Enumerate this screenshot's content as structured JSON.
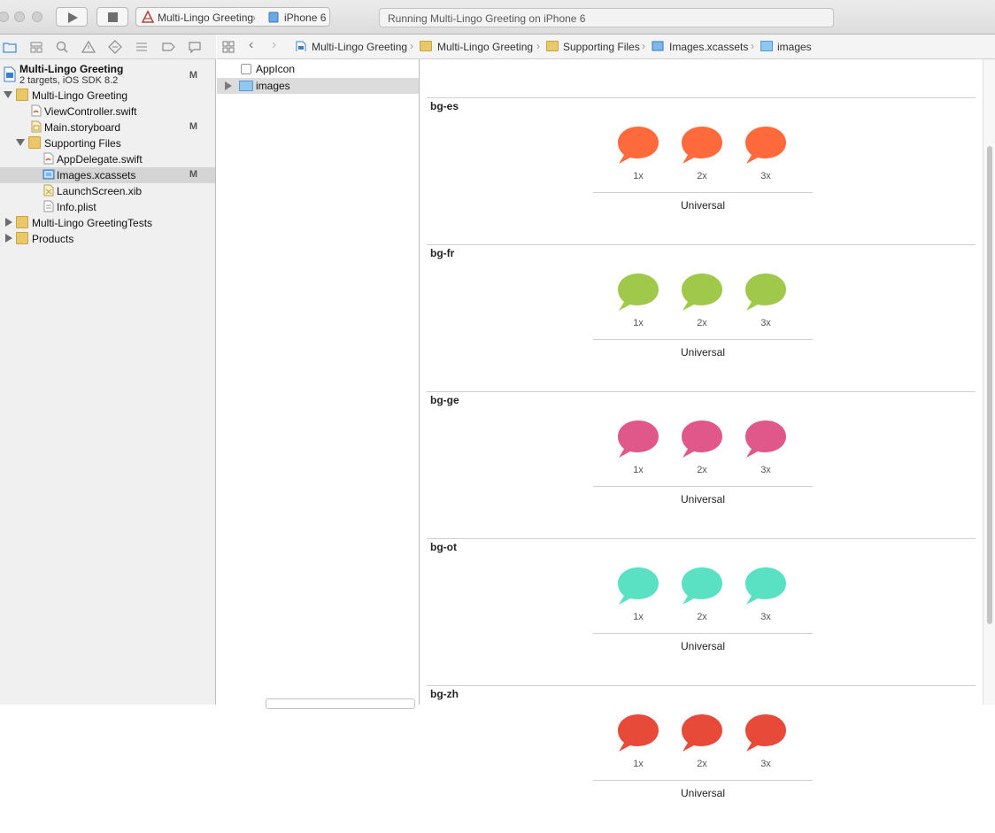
{
  "toolbar": {
    "scheme_name": "Multi-Lingo Greeting",
    "device": "iPhone 6",
    "activity_text": "Running Multi-Lingo Greeting on iPhone 6"
  },
  "navigator": {
    "project": {
      "title": "Multi-Lingo Greeting",
      "subtitle": "2 targets, iOS SDK 8.2",
      "badge": "M"
    },
    "items": [
      {
        "label": "Multi-Lingo Greeting",
        "badge": ""
      },
      {
        "label": "ViewController.swift",
        "badge": ""
      },
      {
        "label": "Main.storyboard",
        "badge": "M"
      },
      {
        "label": "Supporting Files",
        "badge": ""
      },
      {
        "label": "AppDelegate.swift",
        "badge": ""
      },
      {
        "label": "Images.xcassets",
        "badge": "M"
      },
      {
        "label": "LaunchScreen.xib",
        "badge": ""
      },
      {
        "label": "Info.plist",
        "badge": ""
      },
      {
        "label": "Multi-Lingo GreetingTests",
        "badge": ""
      },
      {
        "label": "Products",
        "badge": ""
      }
    ]
  },
  "jumpbar": {
    "crumbs": [
      "Multi-Lingo Greeting",
      "Multi-Lingo Greeting",
      "Supporting Files",
      "Images.xcassets",
      "images"
    ]
  },
  "assets": {
    "items": [
      {
        "label": "AppIcon"
      },
      {
        "label": "images"
      }
    ]
  },
  "editor": {
    "idiom": "Universal",
    "scales": [
      "1x",
      "2x",
      "3x"
    ],
    "sets": [
      {
        "name": "bg-es",
        "color": "#ff6a3d"
      },
      {
        "name": "bg-fr",
        "color": "#a0c84a"
      },
      {
        "name": "bg-ge",
        "color": "#e0578a"
      },
      {
        "name": "bg-ot",
        "color": "#5ae0c2"
      },
      {
        "name": "bg-zh",
        "color": "#e84a3a"
      }
    ]
  },
  "icons": {
    "run": "play-icon",
    "stop": "stop-icon",
    "scheme": "xcode-app-icon",
    "device": "iphone-icon"
  }
}
